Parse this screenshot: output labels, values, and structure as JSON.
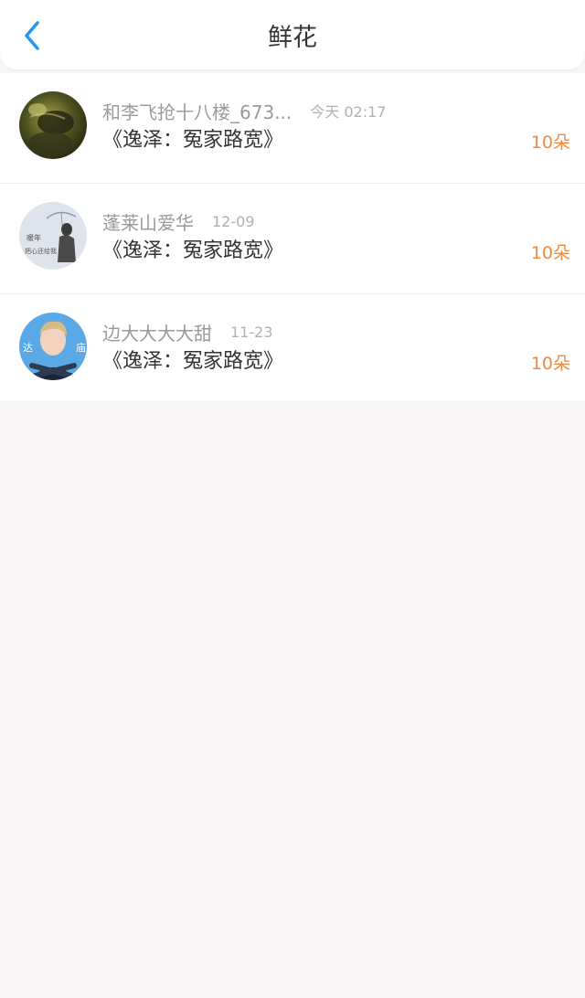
{
  "header": {
    "back_icon": "chevron-left-icon",
    "title": "鲜花"
  },
  "colors": {
    "accent": "#2196f3",
    "count": "#f08a3e",
    "background": "#f8f6f7"
  },
  "items": [
    {
      "username": "和李飞抢十八楼_673...",
      "time": "今天 02:17",
      "book": "《逸泽：冤家路宽》",
      "count": "10朵"
    },
    {
      "username": "蓬莱山爱华",
      "time": "12-09",
      "book": "《逸泽：冤家路宽》",
      "count": "10朵"
    },
    {
      "username": "边大大大大甜",
      "time": "11-23",
      "book": "《逸泽：冤家路宽》",
      "count": "10朵"
    }
  ]
}
